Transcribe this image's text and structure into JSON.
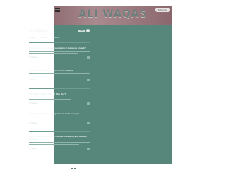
{
  "banner": {
    "title": "ALI WAQAS",
    "subscribe": "Subscribe"
  },
  "publication": {
    "name": "Ali Waqas",
    "subscribe_pill": "Sub"
  },
  "nav": [
    "Home",
    "Archive",
    "About"
  ],
  "posts": [
    {
      "tag": "",
      "title": "What is the role of digital marketing in business growth?",
      "meta": "Ali Waqas"
    },
    {
      "tag": "",
      "title": "What is Search Engine Optimization (SEO)?",
      "meta": "Ali Waqas"
    },
    {
      "tag": "",
      "title": "Is it better to learn SEO or Web Dev?",
      "meta": "Ali Waqas"
    },
    {
      "tag": "",
      "title": "What are the best blogging sites to make money?",
      "meta": "Ali Waqas"
    },
    {
      "tag": "",
      "title": "What is the importance of internet marketing and website design?",
      "meta": "Ali Waqas"
    }
  ]
}
